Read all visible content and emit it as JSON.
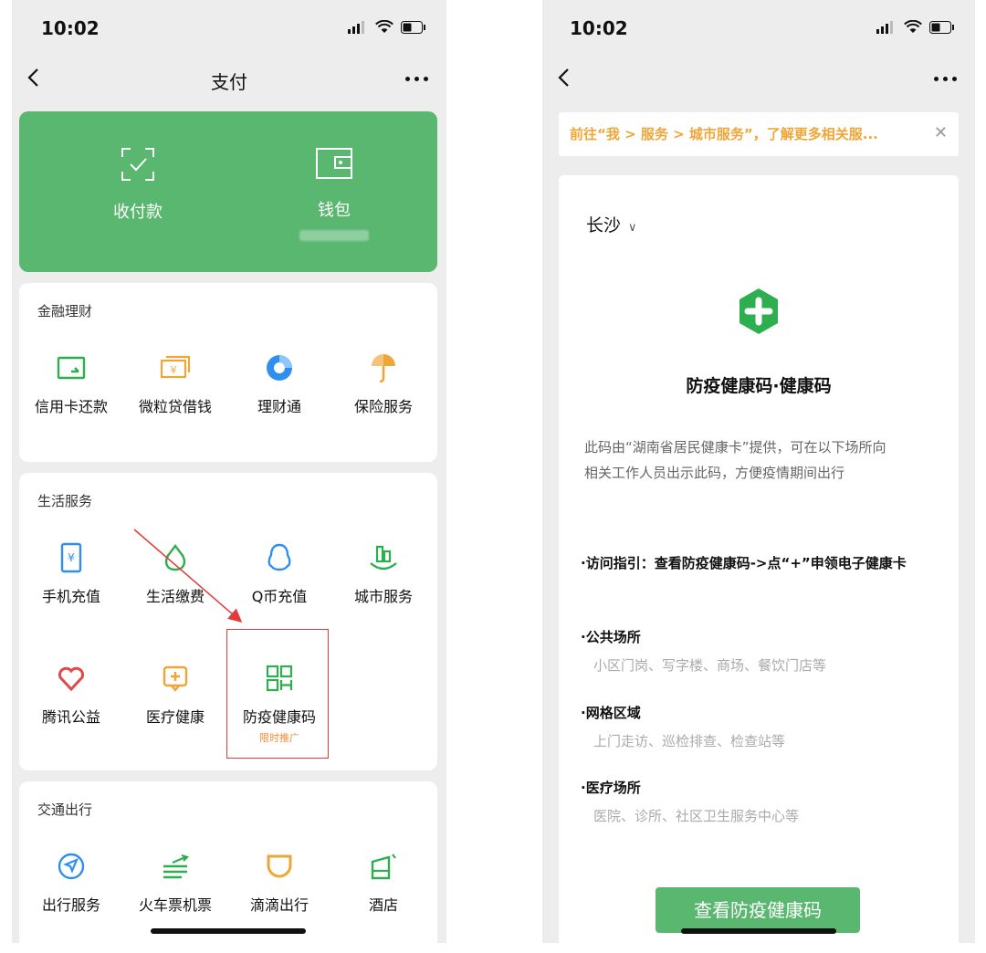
{
  "left_screen": {
    "status_time": "10:02",
    "nav_title": "支付",
    "top_actions": [
      {
        "label": "收付款",
        "icon": "scan-receive-icon"
      },
      {
        "label": "钱包",
        "icon": "wallet-icon"
      }
    ],
    "sections": [
      {
        "title": "金融理财",
        "items": [
          {
            "label": "信用卡还款",
            "icon": "credit-card-icon",
            "color": "#2dae4f"
          },
          {
            "label": "微粒贷借钱",
            "icon": "loan-icon",
            "color": "#f0a537"
          },
          {
            "label": "理财通",
            "icon": "wealth-icon",
            "color": "#2f8ff0"
          },
          {
            "label": "保险服务",
            "icon": "insurance-icon",
            "color": "#f0a537"
          }
        ]
      },
      {
        "title": "生活服务",
        "items": [
          {
            "label": "手机充值",
            "icon": "phone-recharge-icon",
            "color": "#2f8ff0"
          },
          {
            "label": "生活缴费",
            "icon": "utility-bill-icon",
            "color": "#2dae4f"
          },
          {
            "label": "Q币充值",
            "icon": "qq-coin-icon",
            "color": "#2f8ff0"
          },
          {
            "label": "城市服务",
            "icon": "city-service-icon",
            "color": "#2dae4f"
          },
          {
            "label": "腾讯公益",
            "icon": "charity-heart-icon",
            "color": "#e04a4a"
          },
          {
            "label": "医疗健康",
            "icon": "medical-icon",
            "color": "#f0a537"
          },
          {
            "label": "防疫健康码",
            "icon": "health-code-qr-icon",
            "color": "#2dae4f",
            "promo": "限时推广"
          }
        ]
      },
      {
        "title": "交通出行",
        "items": [
          {
            "label": "出行服务",
            "icon": "travel-compass-icon",
            "color": "#2f8ff0"
          },
          {
            "label": "火车票机票",
            "icon": "train-plane-icon",
            "color": "#2dae4f"
          },
          {
            "label": "滴滴出行",
            "icon": "didi-icon",
            "color": "#f0a537"
          },
          {
            "label": "酒店",
            "icon": "hotel-icon",
            "color": "#2dae4f"
          }
        ]
      }
    ]
  },
  "right_screen": {
    "status_time": "10:02",
    "notice": "前往“我 > 服务 > 城市服务”，了解更多相关服...",
    "city": "长沙",
    "title": "防疫健康码·健康码",
    "description": "此码由“湖南省居民健康卡”提供，可在以下场所向相关工作人员出示此码，方便疫情期间出行",
    "guide": "·访问指引：查看防疫健康码->点“+”申领电子健康卡",
    "places": [
      {
        "title": "·公共场所",
        "detail": "小区门岗、写字楼、商场、餐饮门店等"
      },
      {
        "title": "·网格区域",
        "detail": "上门走访、巡检排查、检查站等"
      },
      {
        "title": "·医疗场所",
        "detail": "医院、诊所、社区卫生服务中心等"
      }
    ],
    "button": "查看防疫健康码"
  }
}
